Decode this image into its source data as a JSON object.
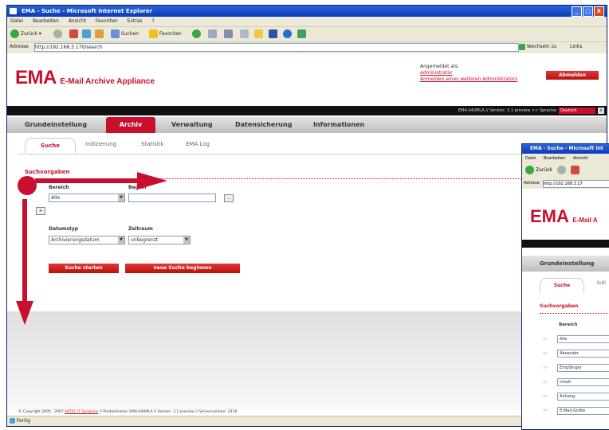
{
  "window": {
    "title": "EMA - Suche - Microsoft Internet Explorer",
    "controls": [
      "_",
      "□",
      "X"
    ]
  },
  "menu": [
    "Datei",
    "Bearbeiten",
    "Ansicht",
    "Favoriten",
    "Extras",
    "?"
  ],
  "toolbar": {
    "back": "Zurück",
    "search": "Suchen",
    "favorites": "Favoriten"
  },
  "address": {
    "label": "Adresse",
    "url": "http://192.168.3.170/search",
    "go": "Wechseln zu",
    "links": "Links"
  },
  "header": {
    "logo_big": "EMA",
    "logo_small": "E-Mail Archive Appliance",
    "logged_in_label": "Angemeldet als:",
    "user": "administrator",
    "other_login": "Anmelden eines weiteren Administrators",
    "logout": "Abmelden"
  },
  "infobar": {
    "version": "EMA-S40MLA // Version: 3.1-preview >> Sprache:",
    "language": "Deutsch",
    "close": "x"
  },
  "nav": [
    "Grundeinstellung",
    "Archiv",
    "Verwaltung",
    "Datensicherung",
    "Informationen"
  ],
  "subtabs": [
    "Suche",
    "Indizierung",
    "Statistik",
    "EMA Log"
  ],
  "form": {
    "section": "Suchvorgaben",
    "bereich_label": "Bereich",
    "begriff_label": "Begriff",
    "bereich_value": "Alle",
    "more_button": "...",
    "add_button": "+",
    "datumstyp_label": "Datumstyp",
    "zeitraum_label": "Zeitraum",
    "datumstyp_value": "Archivierungsdatum",
    "zeitraum_value": "unbegrenzt",
    "start_button": "Suche starten",
    "new_button": "neue Suche beginnen"
  },
  "footer": {
    "copyright_prefix": "© Copyright 2005 - 2007 ",
    "company": "ARTEC IT Solutions",
    "copyright_suffix": " // Produktname: EMA-S40MLA // Version: 3.1-preview // Seriennummer: 2418"
  },
  "status": {
    "text": "Fertig"
  },
  "second_window": {
    "title": "EMA - Suche - Microsoft Int",
    "menu": [
      "Datei",
      "Bearbeiten",
      "Ansicht"
    ],
    "back": "Zurück",
    "address_label": "Adresse",
    "url": "http://192.168.3.17",
    "logo_big": "EMA",
    "logo_small": "E-Mail A",
    "nav": "Grundeinstellung",
    "tab_active": "Suche",
    "tab_next": "Indi",
    "section": "Suchvorgaben",
    "bereich_label": "Bereich",
    "options": [
      "Alle",
      "Absender",
      "Empfänger",
      "Inhalt",
      "Anhang",
      "E-Mail-Größe"
    ]
  },
  "colors": {
    "brand_red": "#c8102e",
    "titlebar_blue": "#0a3cb8",
    "black_bar": "#111111"
  }
}
